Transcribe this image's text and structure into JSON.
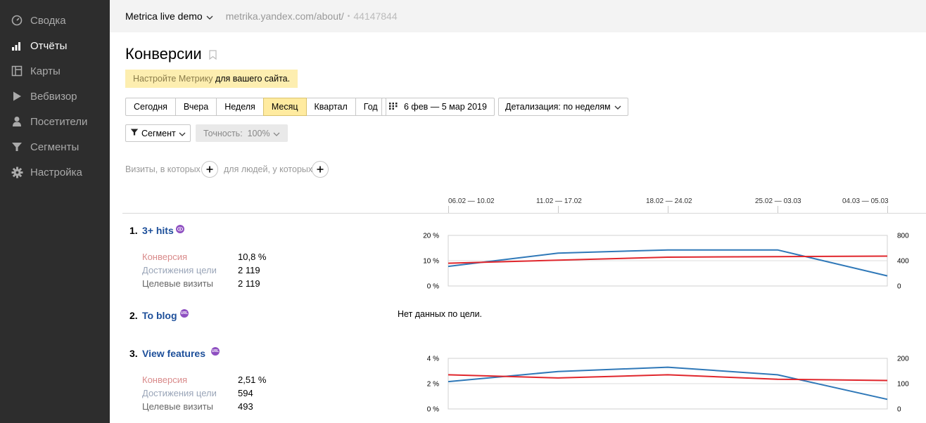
{
  "sidebar": {
    "items": [
      {
        "label": "Сводка",
        "icon": "gauge-icon",
        "active": false
      },
      {
        "label": "Отчёты",
        "icon": "bar-chart-icon",
        "active": true
      },
      {
        "label": "Карты",
        "icon": "map-layout-icon",
        "active": false
      },
      {
        "label": "Вебвизор",
        "icon": "play-icon",
        "active": false
      },
      {
        "label": "Посетители",
        "icon": "user-icon",
        "active": false
      },
      {
        "label": "Сегменты",
        "icon": "filter-icon",
        "active": false
      },
      {
        "label": "Настройка",
        "icon": "gear-icon",
        "active": false
      }
    ]
  },
  "header": {
    "counter_name": "Metrica live demo",
    "counter_url": "metrika.yandex.com/about/",
    "separator": "•",
    "counter_id": "44147844"
  },
  "page": {
    "title": "Конверсии",
    "notice_link": "Настройте Метрику",
    "notice_text": " для вашего сайта."
  },
  "period_buttons": [
    {
      "label": "Сегодня",
      "active": false
    },
    {
      "label": "Вчера",
      "active": false
    },
    {
      "label": "Неделя",
      "active": false
    },
    {
      "label": "Месяц",
      "active": true
    },
    {
      "label": "Квартал",
      "active": false
    },
    {
      "label": "Год",
      "active": false
    }
  ],
  "date_range": "6 фев — 5 мар 2019",
  "detail": "Детализация: по неделям",
  "segment_label": "Сегмент",
  "accuracy_label": "Точность:  100%",
  "conditions": {
    "visits_label": "Визиты, в которых",
    "people_label": "для людей, у которых"
  },
  "periods": [
    "06.02 — 10.02",
    "11.02 — 17.02",
    "18.02 — 24.02",
    "25.02 — 03.03",
    "04.03 — 05.03"
  ],
  "metric_labels": {
    "conversion": "Конверсия",
    "reaches": "Достижения цели",
    "visits": "Целевые визиты"
  },
  "goals": [
    {
      "num": "1.",
      "name": "3+ hits",
      "badge": "eye-icon",
      "conversion": "10,8 %",
      "reaches": "2 119",
      "visits": "2 119"
    },
    {
      "num": "2.",
      "name": "To blog",
      "badge": "url-icon",
      "badge_text": "URL",
      "no_data": "Нет данных по цели."
    },
    {
      "num": "3.",
      "name": "View features",
      "badge": "url-icon",
      "badge_text": "URL",
      "conversion": "2,51 %",
      "reaches": "594",
      "visits": "493"
    }
  ],
  "colors": {
    "conversion_line": "#e0262c",
    "visits_line": "#2f78b8",
    "link": "#1d4f9a",
    "active_button": "#ffeba0",
    "sidebar_bg": "#2d2d2d"
  },
  "chart_data": [
    {
      "type": "line",
      "title": "",
      "categories": [
        "06.02 — 10.02",
        "11.02 — 17.02",
        "18.02 — 24.02",
        "25.02 — 03.03",
        "04.03 — 05.03"
      ],
      "y_left_ticks": [
        "0 %",
        "10 %",
        "20 %"
      ],
      "y_right_ticks": [
        "0",
        "400",
        "800"
      ],
      "y_left_range": [
        0,
        20
      ],
      "y_right_range": [
        0,
        800
      ],
      "series": [
        {
          "axis": "left",
          "color": "#e0262c",
          "values": [
            9.0,
            10.2,
            11.4,
            11.6,
            11.8
          ]
        },
        {
          "axis": "right",
          "color": "#2f78b8",
          "values": [
            310,
            520,
            570,
            570,
            160
          ]
        }
      ]
    },
    {
      "type": "line",
      "title": "",
      "categories": [
        "06.02 — 10.02",
        "11.02 — 17.02",
        "18.02 — 24.02",
        "25.02 — 03.03",
        "04.03 — 05.03"
      ],
      "y_left_ticks": [
        "0 %",
        "2 %",
        "4 %"
      ],
      "y_right_ticks": [
        "0",
        "100",
        "200"
      ],
      "y_left_range": [
        0,
        4
      ],
      "y_right_range": [
        0,
        200
      ],
      "series": [
        {
          "axis": "left",
          "color": "#e0262c",
          "values": [
            2.7,
            2.45,
            2.7,
            2.35,
            2.25
          ]
        },
        {
          "axis": "right",
          "color": "#2f78b8",
          "values": [
            108,
            148,
            165,
            135,
            38
          ]
        }
      ]
    }
  ]
}
